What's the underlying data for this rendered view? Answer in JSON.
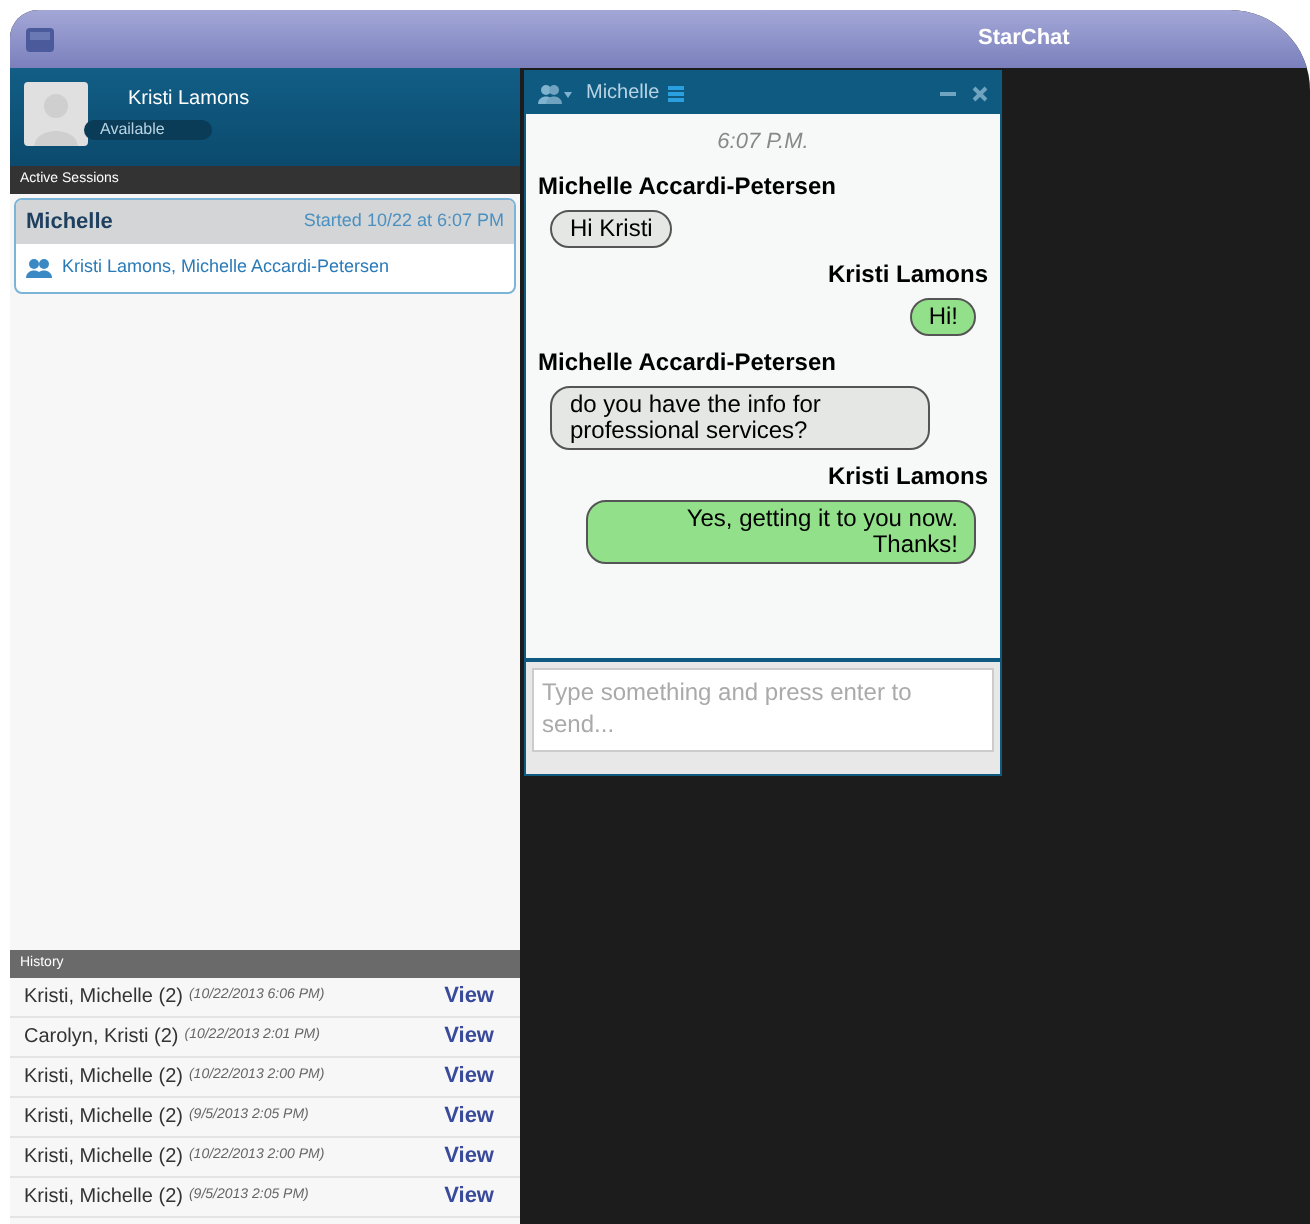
{
  "window": {
    "title": "StarChat"
  },
  "profile": {
    "name": "Kristi Lamons",
    "status": "Available"
  },
  "active_sessions": {
    "heading": "Active Sessions",
    "sessions": [
      {
        "name": "Michelle",
        "started": "Started 10/22 at 6:07 PM",
        "participants": "Kristi Lamons, Michelle Accardi-Petersen",
        "selected": true
      }
    ]
  },
  "history": {
    "heading": "History",
    "rows": [
      {
        "names": "Kristi, Michelle (2)",
        "time": "(10/22/2013 6:06 PM)",
        "action": "View"
      },
      {
        "names": "Carolyn, Kristi (2)",
        "time": "(10/22/2013 2:01 PM)",
        "action": "View"
      },
      {
        "names": "Kristi, Michelle (2)",
        "time": "(10/22/2013 2:00 PM)",
        "action": "View"
      },
      {
        "names": "Kristi, Michelle (2)",
        "time": "(9/5/2013 2:05 PM)",
        "action": "View"
      },
      {
        "names": "Kristi, Michelle (2)",
        "time": "(10/22/2013 2:00 PM)",
        "action": "View"
      },
      {
        "names": "Kristi, Michelle (2)",
        "time": "(9/5/2013 2:05 PM)",
        "action": "View"
      }
    ]
  },
  "chat": {
    "title": "Michelle",
    "timestamp": "6:07 P.M.",
    "messages": [
      {
        "sender": "Michelle Accardi-Petersen",
        "text": "Hi Kristi",
        "kind": "incoming"
      },
      {
        "sender": "Kristi Lamons",
        "text": "Hi!",
        "kind": "outgoing"
      },
      {
        "sender": "Michelle Accardi-Petersen",
        "text": "do you have the info for professional services?",
        "kind": "incoming"
      },
      {
        "sender": "Kristi Lamons",
        "text": "Yes, getting it to you now. Thanks!",
        "kind": "outgoing"
      }
    ],
    "input": {
      "placeholder": "Type something and press enter to send..."
    }
  }
}
